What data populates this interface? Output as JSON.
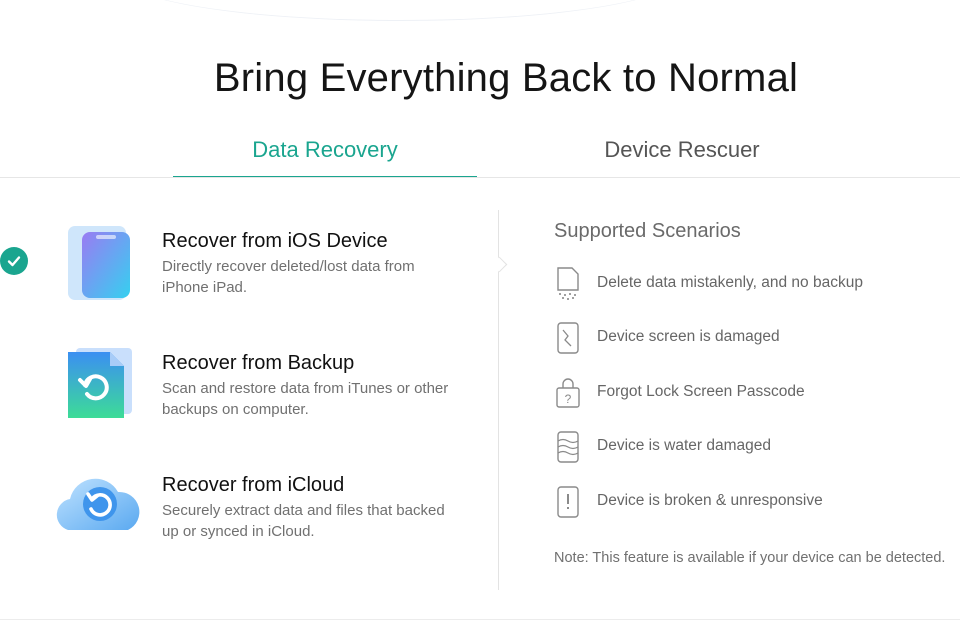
{
  "page": {
    "title": "Bring Everything Back to Normal"
  },
  "tabs": [
    {
      "label": "Data Recovery",
      "active": true
    },
    {
      "label": "Device Rescuer",
      "active": false
    }
  ],
  "options": [
    {
      "title": "Recover from iOS Device",
      "desc": "Directly recover deleted/lost data from iPhone iPad.",
      "icon": "phone-icon",
      "selected": true
    },
    {
      "title": "Recover from Backup",
      "desc": "Scan and restore data from iTunes or other backups on computer.",
      "icon": "backup-file-icon",
      "selected": false
    },
    {
      "title": "Recover from iCloud",
      "desc": "Securely extract data and files that backed up or synced in iCloud.",
      "icon": "icloud-icon",
      "selected": false
    }
  ],
  "scenarios": {
    "title": "Supported Scenarios",
    "items": [
      {
        "label": "Delete data mistakenly, and no backup",
        "icon": "deleted-file-icon"
      },
      {
        "label": "Device screen is damaged",
        "icon": "cracked-screen-icon"
      },
      {
        "label": "Forgot Lock Screen Passcode",
        "icon": "lock-question-icon"
      },
      {
        "label": "Device is water damaged",
        "icon": "water-damage-icon"
      },
      {
        "label": "Device is broken & unresponsive",
        "icon": "broken-device-icon"
      }
    ],
    "note": "Note: This feature is available if your device can be detected."
  },
  "colors": {
    "accent": "#1aa58f",
    "text_primary": "#111111",
    "text_secondary": "#707070"
  }
}
